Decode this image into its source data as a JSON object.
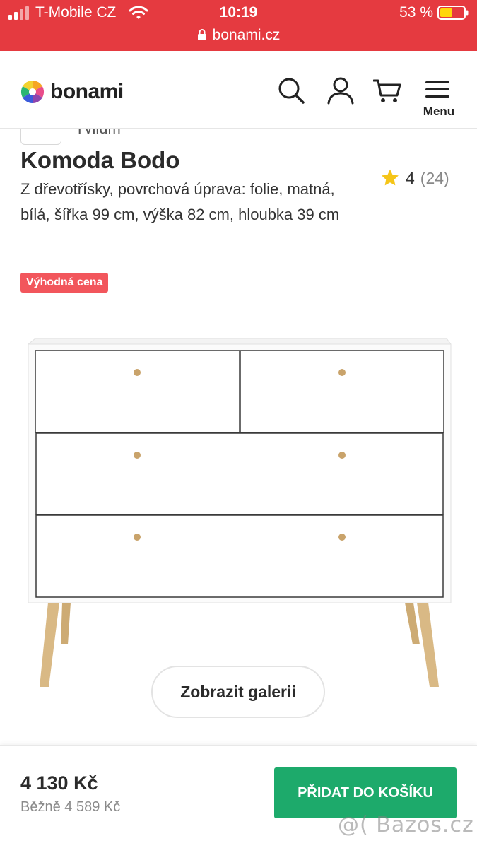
{
  "status_bar": {
    "carrier": "T-Mobile CZ",
    "time": "10:19",
    "battery": "53 %",
    "url": "bonami.cz"
  },
  "header": {
    "logo_text": "bonami",
    "menu_label": "Menu",
    "icons": [
      "search-icon",
      "user-icon",
      "cart-icon",
      "menu-icon"
    ]
  },
  "brand": {
    "name": "Tvilum"
  },
  "product": {
    "title": "Komoda Bodo",
    "description": "Z dřevotřísky, povrchová úprava: folie, matná, bílá, šířka 99 cm, výška 82 cm, hloubka 39 cm",
    "rating_value": "4",
    "rating_count": "(24)",
    "badge": "Výhodná cena",
    "gallery_button": "Zobrazit galerii"
  },
  "purchase": {
    "price": "4 130 Kč",
    "regular_price": "Běžně 4 589 Kč",
    "add_to_cart": "PŘIDAT DO KOŠÍKU"
  },
  "watermark": "@( Bazos.cz",
  "colors": {
    "status_bar": "#e53a40",
    "badge": "#f2565c",
    "cart_button": "#1daa6b",
    "star": "#f5c518"
  }
}
